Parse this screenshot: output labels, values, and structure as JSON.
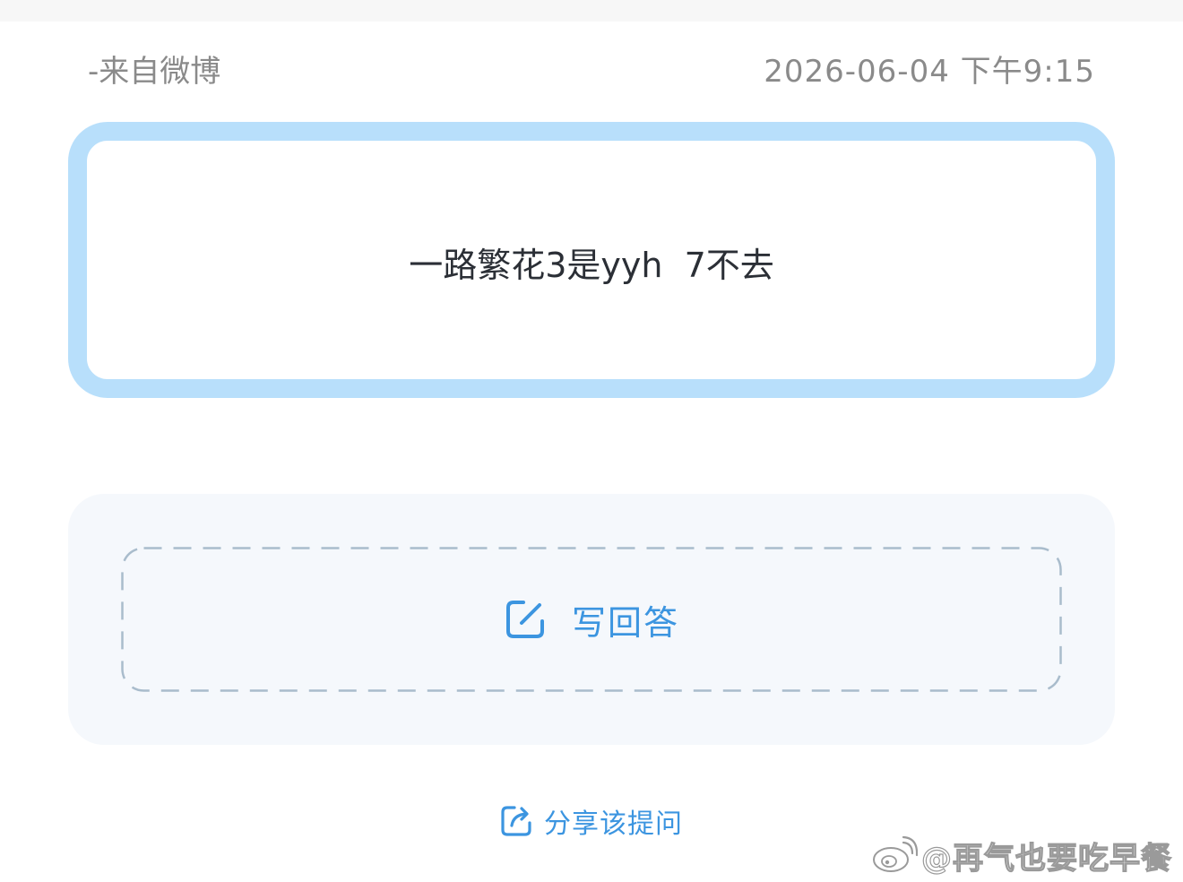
{
  "meta": {
    "source": "-来自微博",
    "timestamp": "2026-06-04 下午9:15"
  },
  "question": {
    "text": "一路繁花3是yyh  7不去"
  },
  "answer": {
    "button_label": "写回答",
    "icon": "edit-icon"
  },
  "share": {
    "label": "分享该提问",
    "icon": "share-icon"
  },
  "watermark": {
    "text": "@再气也要吃早餐",
    "icon": "weibo-logo"
  },
  "colors": {
    "accent": "#3c95e0",
    "card_border": "#b8dffb",
    "panel_bg": "#f5f8fc",
    "dash": "#a9bccc",
    "meta_text": "#8a8a8a"
  }
}
